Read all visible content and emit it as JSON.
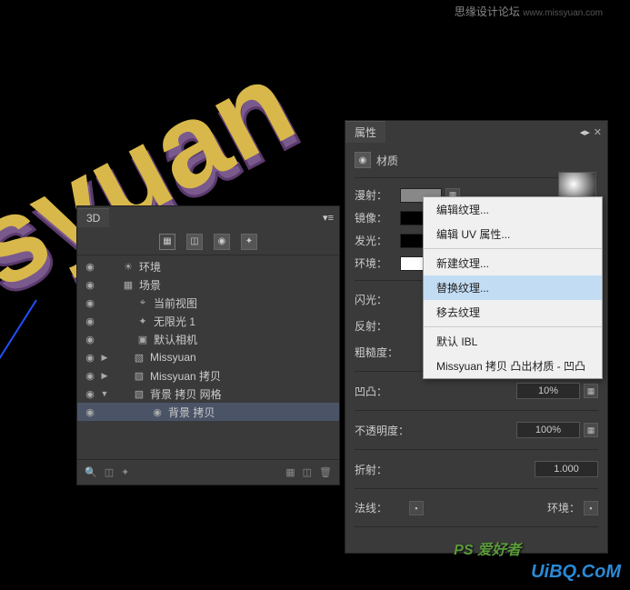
{
  "header": {
    "site": "思缘设计论坛",
    "url": "www.missyuan.com"
  },
  "panel3d": {
    "tab": "3D",
    "items": [
      {
        "icon": "light-icon",
        "label": "环境",
        "indent": 1
      },
      {
        "icon": "scene-icon",
        "label": "场景",
        "indent": 1
      },
      {
        "icon": "view-icon",
        "label": "当前视图",
        "indent": 2
      },
      {
        "icon": "light-icon",
        "label": "无限光 1",
        "indent": 2
      },
      {
        "icon": "camera-icon",
        "label": "默认相机",
        "indent": 2
      },
      {
        "icon": "mesh-icon",
        "label": "Missyuan",
        "indent": 2,
        "expand": "▶"
      },
      {
        "icon": "mesh-icon",
        "label": "Missyuan 拷贝",
        "indent": 2,
        "expand": "▶"
      },
      {
        "icon": "mesh-icon",
        "label": "背景 拷贝 网格",
        "indent": 2,
        "expand": "▼"
      },
      {
        "icon": "material-icon",
        "label": "背景 拷贝",
        "indent": 3,
        "selected": true
      }
    ]
  },
  "props": {
    "tab": "属性",
    "section": "材质",
    "rows": {
      "diffuse": "漫射：",
      "specular": "镜像：",
      "illumination": "发光：",
      "ambient": "环境：",
      "shine": "闪光：",
      "reflection": "反射：",
      "roughness": "粗糙度：",
      "bump": "凹凸：",
      "bump_val": "10%",
      "opacity": "不透明度：",
      "opacity_val": "100%",
      "refraction": "折射：",
      "refraction_val": "1.000",
      "normal": "法线：",
      "environment": "环境："
    }
  },
  "context_menu": {
    "items": [
      "编辑纹理...",
      "编辑 UV 属性...",
      "新建纹理...",
      "替换纹理...",
      "移去纹理",
      "默认 IBL",
      "Missyuan 拷贝 凸出材质 - 凹凸"
    ],
    "highlight_index": 3
  },
  "watermark": {
    "ps": "PS 爱好者",
    "domain": "UiBQ.CoM"
  }
}
